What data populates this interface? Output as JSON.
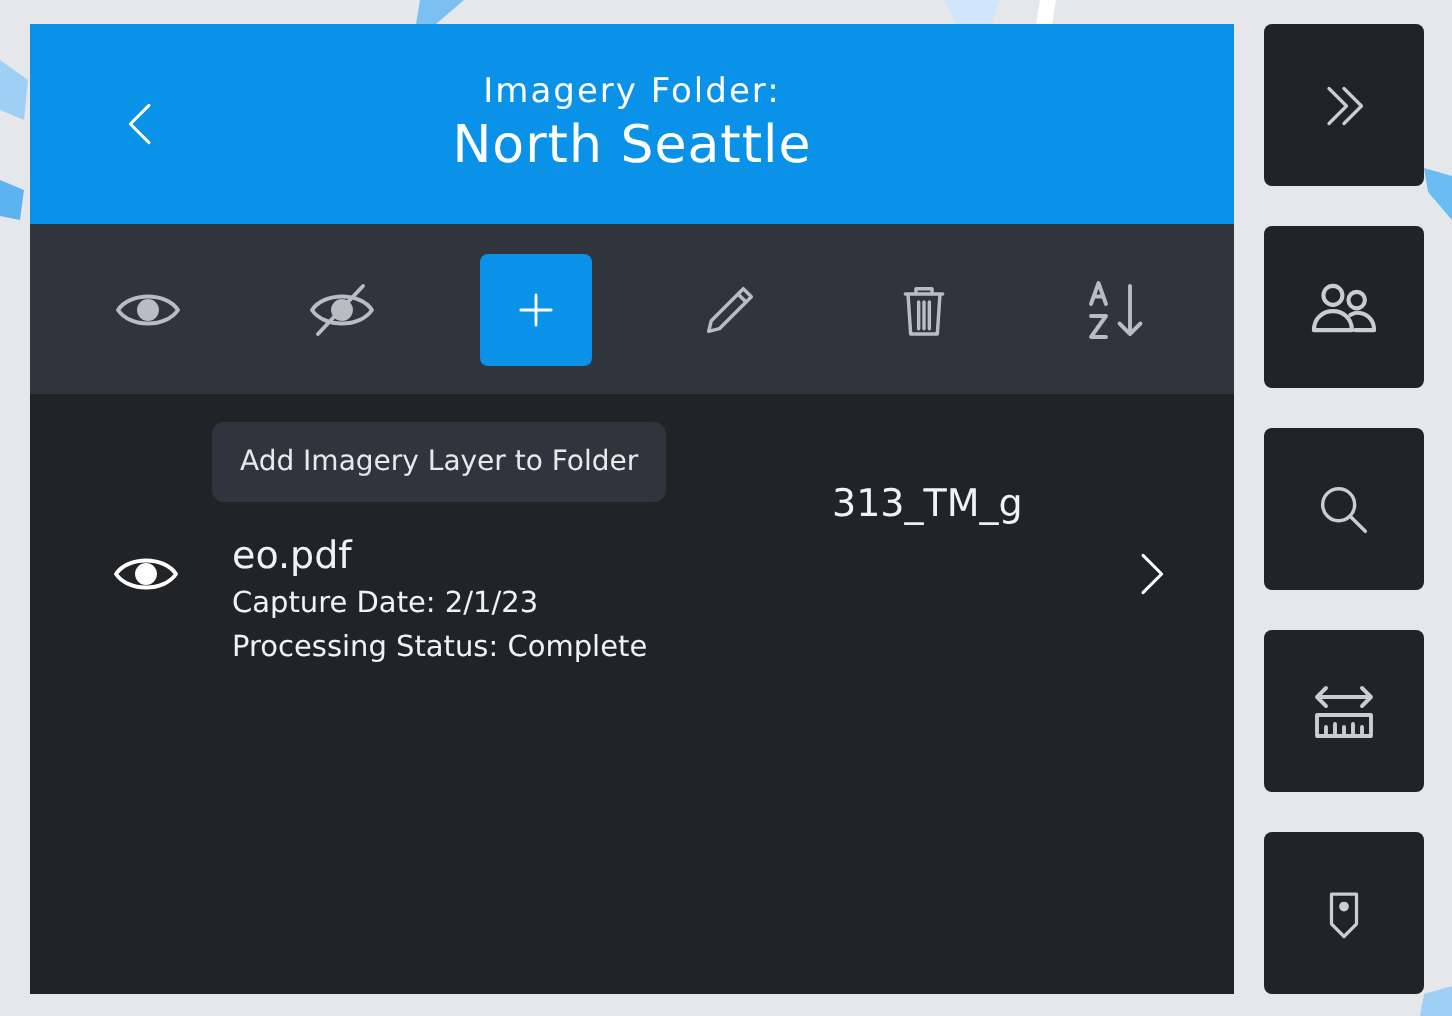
{
  "header": {
    "subtitle": "Imagery Folder:",
    "title": "North Seattle"
  },
  "toolbar": [
    {
      "kind": "show",
      "selected": false
    },
    {
      "kind": "hide",
      "selected": false
    },
    {
      "kind": "add",
      "selected": true
    },
    {
      "kind": "edit",
      "selected": false
    },
    {
      "kind": "delete",
      "selected": false
    },
    {
      "kind": "sort",
      "selected": false
    }
  ],
  "tooltip": "Add Imagery Layer to Folder",
  "layers": [
    {
      "visible": true,
      "name_lines": [
        "313_TM_g",
        "eo.pdf"
      ],
      "capture_date": "Capture Date: 2/1/23",
      "status": "Processing Status: Complete"
    }
  ],
  "side_buttons": [
    {
      "kind": "collapse"
    },
    {
      "kind": "users"
    },
    {
      "kind": "search"
    },
    {
      "kind": "measure"
    },
    {
      "kind": "pin"
    }
  ]
}
